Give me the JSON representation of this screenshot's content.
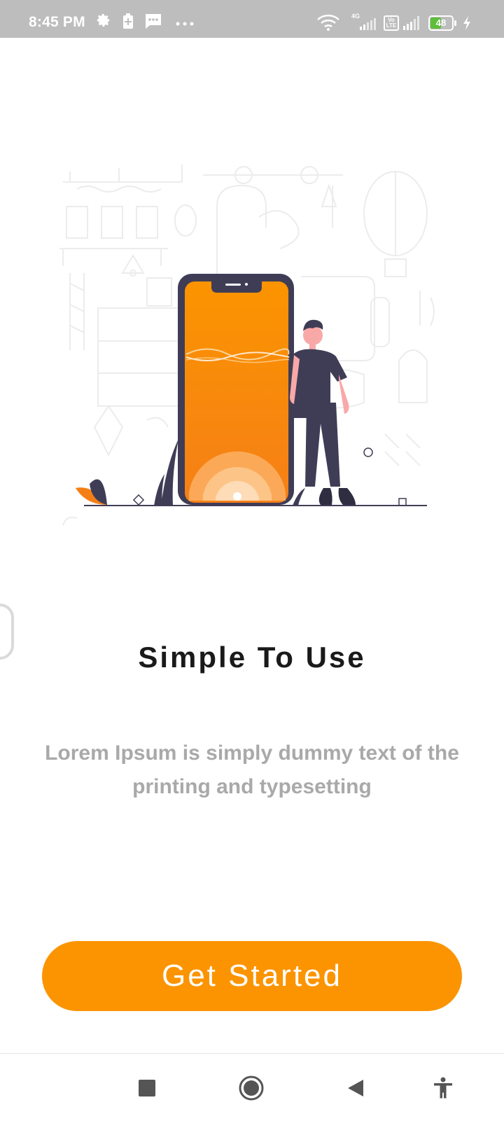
{
  "status_bar": {
    "time": "8:45 PM",
    "battery_level": "48",
    "network_label": "4G",
    "volte_label": "Vo LTE",
    "icons": [
      "settings-icon",
      "battery-saver-icon",
      "message-icon",
      "more-dots-icon",
      "wifi-icon",
      "signal-4g-icon",
      "volte-icon",
      "signal-icon",
      "battery-icon",
      "charging-icon"
    ]
  },
  "onboarding": {
    "title": "Simple To Use",
    "description": "Lorem Ipsum is simply dummy text of the printing and typesetting",
    "button_label": "Get Started"
  },
  "colors": {
    "accent": "#fb9400",
    "status_bar": "#bdbdbd",
    "title": "#1a1a1a",
    "description": "#a9a9a9",
    "figure_dark": "#3f3d56",
    "skin": "#f9a8a8"
  },
  "nav_bar": {
    "icons": [
      "recent-apps-icon",
      "home-icon",
      "back-icon",
      "accessibility-icon"
    ]
  }
}
